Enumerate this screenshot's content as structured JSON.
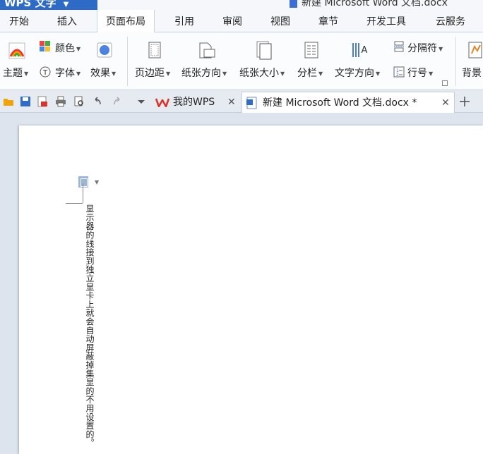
{
  "app": {
    "menu_label": "WPS 文字",
    "caret": "▼"
  },
  "window": {
    "doc_title": "新建 Microsoft Word 文档.docx"
  },
  "menu_tabs": [
    {
      "label": "开始"
    },
    {
      "label": "插入"
    },
    {
      "label": "页面布局",
      "active": true
    },
    {
      "label": "引用"
    },
    {
      "label": "审阅"
    },
    {
      "label": "视图"
    },
    {
      "label": "章节"
    },
    {
      "label": "开发工具"
    },
    {
      "label": "云服务"
    }
  ],
  "ribbon": {
    "theme": "主题",
    "color": "颜色",
    "font": "字体",
    "effect": "效果",
    "margins": "页边距",
    "orientation": "纸张方向",
    "size": "纸张大小",
    "columns": "分栏",
    "text_direction": "文字方向",
    "separator": "分隔符",
    "line_number": "行号",
    "background": "背景"
  },
  "doc_tabs": [
    {
      "label": "我的WPS"
    },
    {
      "label": "新建 Microsoft Word 文档.docx *",
      "active": true
    }
  ],
  "document": {
    "text": "显示器的线接到独立显卡上就会自动屏蔽掉集显的不用设置的。"
  },
  "colors": {
    "accent": "#2e6bc6",
    "wps_red": "#d9342b"
  }
}
